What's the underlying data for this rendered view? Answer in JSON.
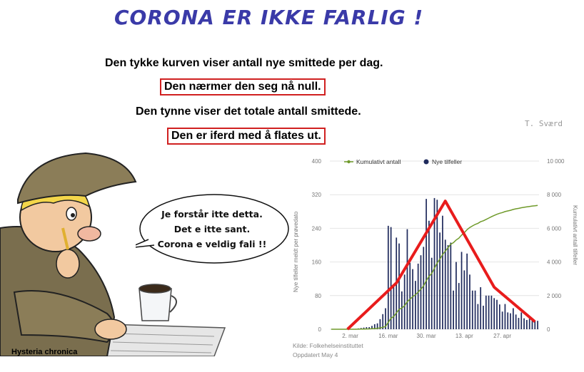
{
  "title": "CORONA ER IKKE FARLIG !",
  "captions": {
    "line1": "Den tykke kurven viser antall nye smittede per dag.",
    "line2": "Den nærmer den seg nå null.",
    "line3": "Den tynne viser det totale antall smittede.",
    "line4": "Den er iferd med å flates ut."
  },
  "signature": "T. Sværd",
  "speech": [
    "Je forstår itte detta.",
    "Det e itte sant.",
    "Corona e veldig fali !!"
  ],
  "cartoon_caption": "Hysteria chronica",
  "source": "Kilde: Folkehelseinstituttet",
  "updated": "Oppdatert May 4",
  "colors": {
    "title": "#3a3aa8",
    "bars": "#1f2a5c",
    "cumulative": "#6f9a2a",
    "overlay": "#e81c1c",
    "box": "#d02020"
  },
  "chart_data": {
    "type": "bar",
    "x_ticks": [
      "2. mar",
      "16. mar",
      "30. mar",
      "13. apr",
      "27. apr"
    ],
    "y_left": {
      "label": "Nye tilfeller meldt per prøvedato",
      "ticks": [
        0,
        80,
        160,
        240,
        320,
        400
      ],
      "ylim": [
        0,
        400
      ]
    },
    "y_right": {
      "label": "Kumulativt antall tilfeller",
      "ticks": [
        0,
        2000,
        4000,
        6000,
        8000,
        10000
      ],
      "ylim": [
        0,
        10000
      ]
    },
    "legend": [
      "Kumulativt antall",
      "Nye tilfeller"
    ],
    "legend_position": "top",
    "series": [
      {
        "name": "Nye tilfeller",
        "values": [
          0,
          0,
          0,
          0,
          0,
          0,
          0,
          0,
          1,
          1,
          2,
          3,
          4,
          5,
          5,
          8,
          12,
          14,
          24,
          36,
          50,
          246,
          243,
          100,
          218,
          204,
          90,
          130,
          238,
          158,
          143,
          115,
          156,
          176,
          196,
          310,
          258,
          170,
          312,
          308,
          230,
          270,
          213,
          200,
          206,
          92,
          160,
          110,
          184,
          140,
          180,
          130,
          92,
          92,
          60,
          100,
          56,
          80,
          80,
          80,
          74,
          70,
          59,
          42,
          60,
          40,
          38,
          50,
          35,
          27,
          40,
          26,
          22,
          25,
          26,
          20,
          20
        ]
      },
      {
        "name": "Kumulativt antall",
        "values": [
          0,
          0,
          0,
          0,
          0,
          0,
          0,
          0,
          1,
          2,
          4,
          7,
          11,
          16,
          21,
          29,
          41,
          55,
          79,
          115,
          165,
          411,
          654,
          754,
          972,
          1176,
          1266,
          1396,
          1634,
          1792,
          1935,
          2050,
          2206,
          2382,
          2578,
          2888,
          3146,
          3316,
          3628,
          3936,
          4166,
          4436,
          4649,
          4849,
          5055,
          5147,
          5307,
          5417,
          5601,
          5741,
          5921,
          6051,
          6143,
          6235,
          6295,
          6395,
          6451,
          6531,
          6611,
          6691,
          6765,
          6835,
          6894,
          6936,
          6996,
          7036,
          7074,
          7124,
          7159,
          7186,
          7226,
          7252,
          7274,
          7299,
          7325,
          7345,
          7365
        ]
      }
    ],
    "overlay_trend": {
      "x_index": [
        6,
        24,
        42,
        60,
        75
      ],
      "values": [
        0,
        110,
        305,
        100,
        18
      ]
    }
  }
}
